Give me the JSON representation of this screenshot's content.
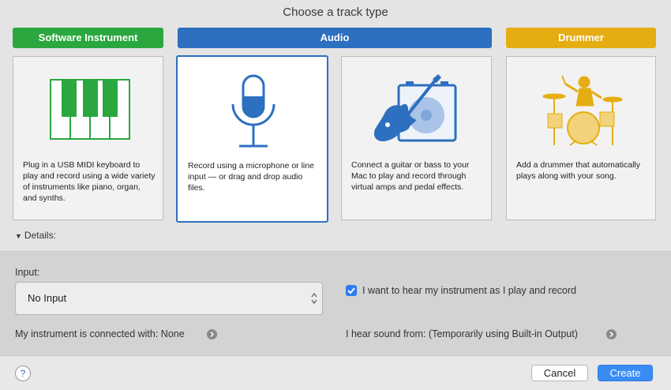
{
  "dialog": {
    "title": "Choose a track type"
  },
  "categories": {
    "software": {
      "label": "Software Instrument",
      "color": "#2aa73f"
    },
    "audio": {
      "label": "Audio",
      "color": "#2d6fc0"
    },
    "drummer": {
      "label": "Drummer",
      "color": "#e6ad13"
    }
  },
  "cards": {
    "software": {
      "description": "Plug in a USB MIDI keyboard to play and record using a wide variety of instruments like piano, organ, and synths.",
      "icon": "piano-keys-icon"
    },
    "mic": {
      "description": "Record using a microphone or line input — or drag and drop audio files.",
      "icon": "microphone-icon",
      "selected": true
    },
    "guitar": {
      "description": "Connect a guitar or bass to your Mac to play and record through virtual amps and pedal effects.",
      "icon": "guitar-amp-icon"
    },
    "drummer": {
      "description": "Add a drummer that automatically plays along with your song.",
      "icon": "drummer-icon"
    }
  },
  "details": {
    "label": "Details:"
  },
  "input": {
    "label": "Input:",
    "value": "No Input",
    "connected_label": "My instrument is connected with: None"
  },
  "monitor": {
    "checked": true,
    "label": "I want to hear my instrument as I play and record",
    "output_label": "I hear sound from: (Temporarily using Built-in Output)"
  },
  "footer": {
    "help": "?",
    "cancel": "Cancel",
    "create": "Create"
  }
}
